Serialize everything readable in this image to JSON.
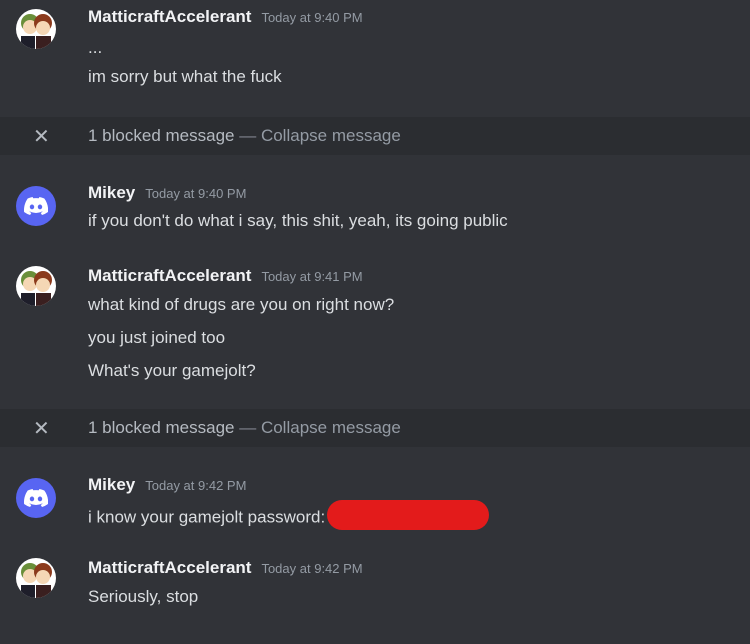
{
  "messages": [
    {
      "author": "MatticraftAccelerant",
      "timestamp": "Today at 9:40 PM",
      "lines": [
        "...",
        "im sorry but what the fuck"
      ]
    },
    {
      "blocked": true,
      "count_text": "1 blocked message",
      "separator": "—",
      "collapse_label": "Collapse message"
    },
    {
      "author": "Mikey",
      "timestamp": "Today at 9:40 PM",
      "lines": [
        "if you don't do what i say, this shit, yeah, its going public"
      ]
    },
    {
      "author": "MatticraftAccelerant",
      "timestamp": "Today at 9:41 PM",
      "lines": [
        "what kind of drugs are you on right now?",
        "you just joined too",
        "What's your gamejolt?"
      ]
    },
    {
      "blocked": true,
      "count_text": "1 blocked message",
      "separator": "—",
      "collapse_label": "Collapse message"
    },
    {
      "author": "Mikey",
      "timestamp": "Today at 9:42 PM",
      "lines": [
        "i know your gamejolt password:"
      ]
    },
    {
      "author": "MatticraftAccelerant",
      "timestamp": "Today at 9:42 PM",
      "lines": [
        "Seriously, stop"
      ]
    }
  ],
  "icons": {
    "blocked_close": "close-icon",
    "discord_avatar": "discord-logo-icon"
  },
  "colors": {
    "background": "#313338",
    "blocked_bg": "#2b2d31",
    "discord_blurple": "#5865f2",
    "redaction": "#e31b1b"
  }
}
